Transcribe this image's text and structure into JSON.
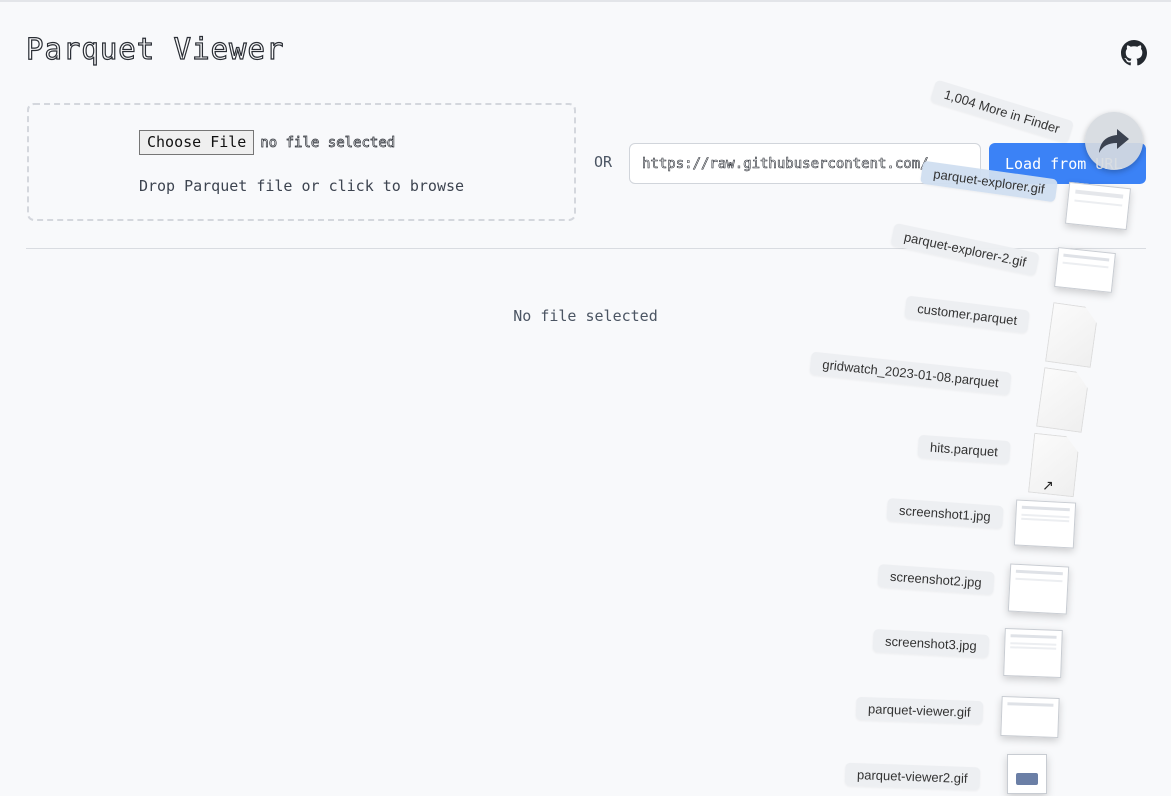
{
  "header": {
    "title": "Parquet Viewer",
    "github_icon": "github-icon"
  },
  "upload": {
    "choose_file_label": "Choose File",
    "file_status": "no file selected",
    "drop_hint": "Drop Parquet file or click to browse"
  },
  "url_loader": {
    "or_label": "OR",
    "url_value": "https://raw.githubusercontent.com/",
    "load_button_label": "Load from URL"
  },
  "main": {
    "status": "No file selected"
  },
  "drag_stack": {
    "more_label": "1,004 More in Finder",
    "share_icon": "share-arrow-icon",
    "files": [
      {
        "name": "parquet-explorer.gif",
        "kind": "image"
      },
      {
        "name": "parquet-explorer-2.gif",
        "kind": "image"
      },
      {
        "name": "customer.parquet",
        "kind": "document"
      },
      {
        "name": "gridwatch_2023-01-08.parquet",
        "kind": "document"
      },
      {
        "name": "hits.parquet",
        "kind": "document"
      },
      {
        "name": "screenshot1.jpg",
        "kind": "image"
      },
      {
        "name": "screenshot2.jpg",
        "kind": "image"
      },
      {
        "name": "screenshot3.jpg",
        "kind": "image"
      },
      {
        "name": "parquet-viewer.gif",
        "kind": "image"
      },
      {
        "name": "parquet-viewer2.gif",
        "kind": "image"
      }
    ]
  },
  "colors": {
    "accent": "#3b82f6",
    "background": "#f8f9fb"
  }
}
